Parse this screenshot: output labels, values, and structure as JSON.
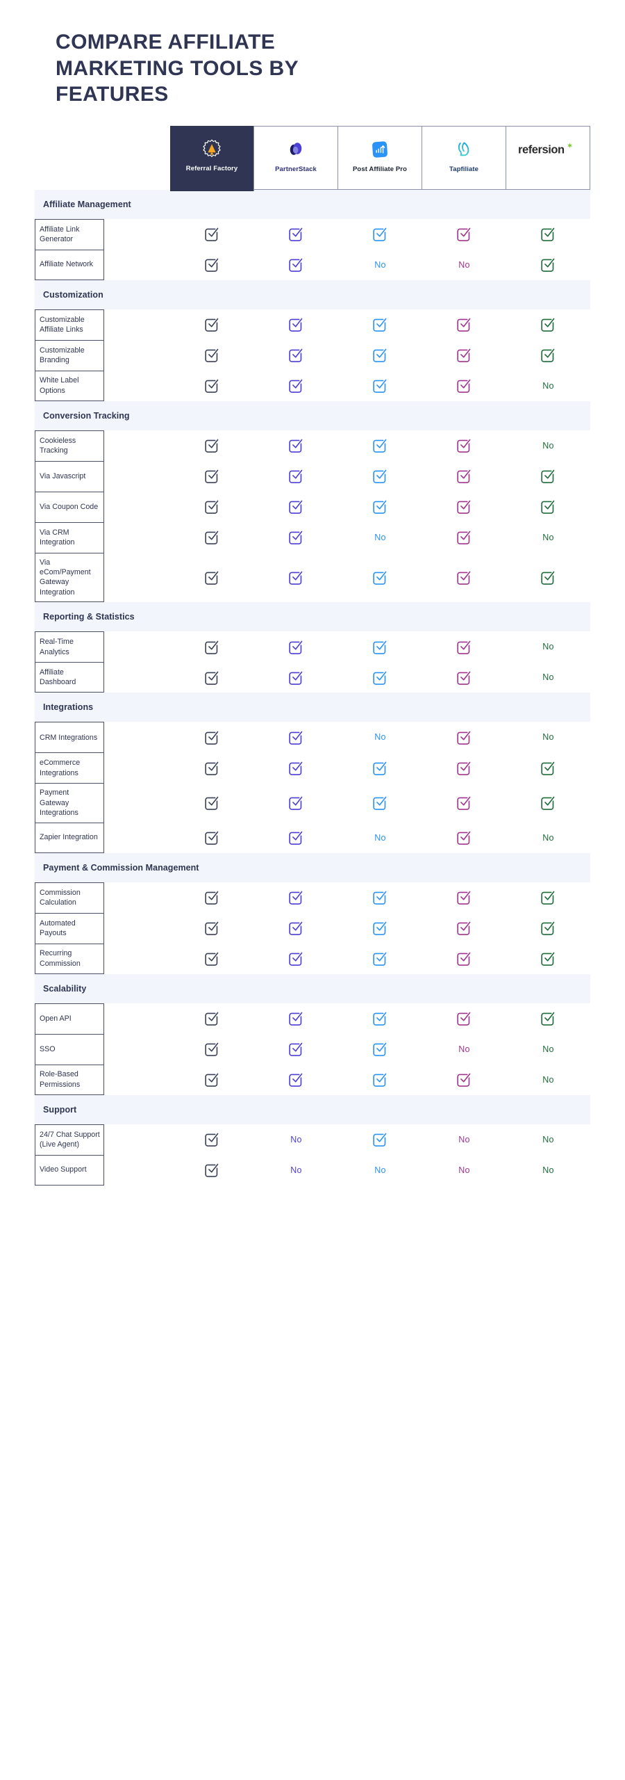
{
  "page": {
    "title": "COMPARE AFFILIATE MARKETING TOOLS BY FEATURES",
    "background": "#ffffff",
    "heading_color": "#2f3552",
    "section_band_color": "#f2f6fc",
    "featured_column_bg": "#2f3552"
  },
  "columns": [
    {
      "name": "Referral Factory",
      "icon": "referral-factory-logo-icon",
      "accent": "#3b4158",
      "label_color": "#ffffff",
      "featured": true
    },
    {
      "name": "PartnerStack",
      "icon": "partnerstack-logo-icon",
      "accent": "#4b3fd4",
      "label_color": "#2b2f77",
      "featured": false
    },
    {
      "name": "Post Affiliate Pro",
      "icon": "post-affiliate-pro-logo-icon",
      "accent": "#2a93f5",
      "label_color": "#1d2433",
      "featured": false
    },
    {
      "name": "Tapfiliate",
      "icon": "tapfiliate-logo-icon",
      "accent": "#a0358f",
      "label_color": "#1c3b73",
      "featured": false
    },
    {
      "name": "refersion",
      "icon": "refersion-logo-icon",
      "accent": "#1f6b3a",
      "label_color": "#2b2b2b",
      "featured": false
    }
  ],
  "no_label": "No",
  "sections": [
    {
      "title": "Affiliate Management",
      "rows": [
        {
          "feature": "Affiliate Link Generator",
          "values": [
            "yes",
            "yes",
            "yes",
            "yes",
            "yes"
          ]
        },
        {
          "feature": "Affiliate Network",
          "values": [
            "yes",
            "yes",
            "no",
            "no",
            "yes"
          ]
        }
      ]
    },
    {
      "title": "Customization",
      "rows": [
        {
          "feature": "Customizable Affiliate Links",
          "values": [
            "yes",
            "yes",
            "yes",
            "yes",
            "yes"
          ]
        },
        {
          "feature": "Customizable Branding",
          "values": [
            "yes",
            "yes",
            "yes",
            "yes",
            "yes"
          ]
        },
        {
          "feature": "White Label Options",
          "values": [
            "yes",
            "yes",
            "yes",
            "yes",
            "no"
          ]
        }
      ]
    },
    {
      "title": "Conversion Tracking",
      "rows": [
        {
          "feature": "Cookieless Tracking",
          "values": [
            "yes",
            "yes",
            "yes",
            "yes",
            "no"
          ]
        },
        {
          "feature": "Via Javascript",
          "values": [
            "yes",
            "yes",
            "yes",
            "yes",
            "yes"
          ]
        },
        {
          "feature": "Via Coupon Code",
          "values": [
            "yes",
            "yes",
            "yes",
            "yes",
            "yes"
          ]
        },
        {
          "feature": "Via CRM Integration",
          "values": [
            "yes",
            "yes",
            "no",
            "yes",
            "no"
          ]
        },
        {
          "feature": "Via eCom/Payment Gateway Integration",
          "values": [
            "yes",
            "yes",
            "yes",
            "yes",
            "yes"
          ]
        }
      ]
    },
    {
      "title": "Reporting & Statistics",
      "rows": [
        {
          "feature": "Real-Time Analytics",
          "values": [
            "yes",
            "yes",
            "yes",
            "yes",
            "no"
          ]
        },
        {
          "feature": "Affiliate Dashboard",
          "values": [
            "yes",
            "yes",
            "yes",
            "yes",
            "no"
          ]
        }
      ]
    },
    {
      "title": "Integrations",
      "rows": [
        {
          "feature": "CRM Integrations",
          "values": [
            "yes",
            "yes",
            "no",
            "yes",
            "no"
          ]
        },
        {
          "feature": "eCommerce Integrations",
          "values": [
            "yes",
            "yes",
            "yes",
            "yes",
            "yes"
          ]
        },
        {
          "feature": "Payment Gateway Integrations",
          "values": [
            "yes",
            "yes",
            "yes",
            "yes",
            "yes"
          ]
        },
        {
          "feature": "Zapier Integration",
          "values": [
            "yes",
            "yes",
            "no",
            "yes",
            "no"
          ]
        }
      ]
    },
    {
      "title": "Payment & Commission Management",
      "rows": [
        {
          "feature": "Commission Calculation",
          "values": [
            "yes",
            "yes",
            "yes",
            "yes",
            "yes"
          ]
        },
        {
          "feature": "Automated Payouts",
          "values": [
            "yes",
            "yes",
            "yes",
            "yes",
            "yes"
          ]
        },
        {
          "feature": "Recurring Commission",
          "values": [
            "yes",
            "yes",
            "yes",
            "yes",
            "yes"
          ]
        }
      ]
    },
    {
      "title": "Scalability",
      "rows": [
        {
          "feature": "Open API",
          "values": [
            "yes",
            "yes",
            "yes",
            "yes",
            "yes"
          ]
        },
        {
          "feature": "SSO",
          "values": [
            "yes",
            "yes",
            "yes",
            "no",
            "no"
          ]
        },
        {
          "feature": "Role-Based Permissions",
          "values": [
            "yes",
            "yes",
            "yes",
            "yes",
            "no"
          ]
        }
      ]
    },
    {
      "title": "Support",
      "rows": [
        {
          "feature": "24/7 Chat Support (Live Agent)",
          "values": [
            "yes",
            "no",
            "yes",
            "no",
            "no"
          ]
        },
        {
          "feature": "Video Support",
          "values": [
            "yes",
            "no",
            "no",
            "no",
            "no"
          ]
        }
      ]
    }
  ]
}
